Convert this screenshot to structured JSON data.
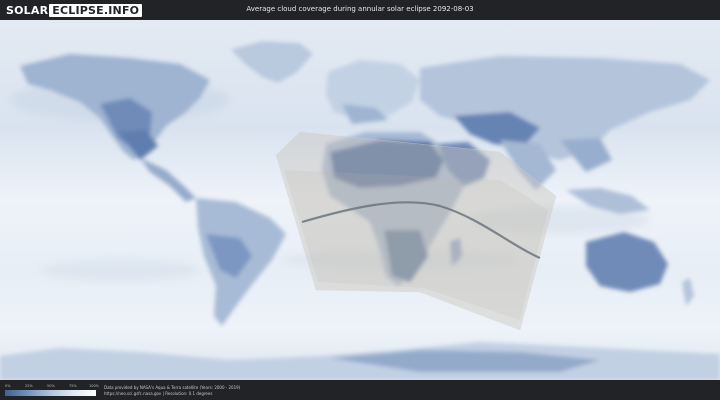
{
  "header": {
    "logo_solar": "SOLAR",
    "logo_rest": "ECLIPSE.INFO",
    "title": "Average cloud coverage during annular solar eclipse 2092-08-03"
  },
  "legend": {
    "ticks": [
      "0%",
      "25%",
      "50%",
      "75%",
      "100%"
    ],
    "color_low": "#3f6291",
    "color_high": "#ffffff"
  },
  "credits": {
    "line1": "Data provided by NASA's Aqua & Terra satellite (Years: 2000 - 2019)",
    "line2": "https://neo.sci.gsfc.nasa.gov | Resolution: 0.1 degrees"
  },
  "colors": {
    "background": "#222326",
    "ocean_cloud": "#e7eef6",
    "land_clear": "#6f8bb8",
    "eclipse_zone": "#c9c4bb",
    "central_path": "#6c747e"
  }
}
